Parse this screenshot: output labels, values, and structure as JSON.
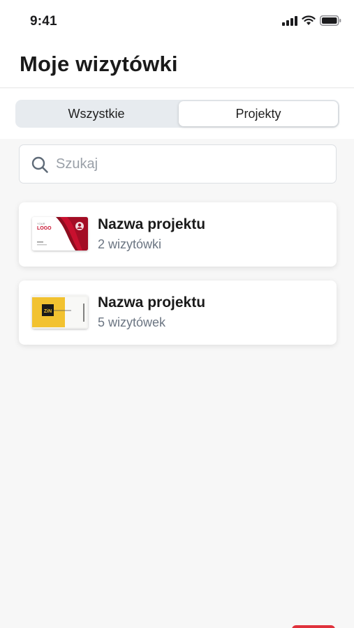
{
  "status_bar": {
    "time": "9:41",
    "icons": [
      "signal-icon",
      "wifi-icon",
      "battery-icon"
    ]
  },
  "header": {
    "title": "Moje wizytówki"
  },
  "tabs": {
    "items": [
      {
        "label": "Wszystkie",
        "selected": false
      },
      {
        "label": "Projekty",
        "selected": true
      }
    ]
  },
  "search": {
    "placeholder": "Szukaj",
    "value": "",
    "icon": "search-icon"
  },
  "projects": [
    {
      "name": "Nazwa projektu",
      "count": "2 wizytówki",
      "thumbnail": {
        "icon": "business-card-red-thumbnail",
        "logo_text": "LOGO",
        "logo_small": "YOUR",
        "accent": "#c8102e"
      }
    },
    {
      "name": "Nazwa projektu",
      "count": "5 wizytówek",
      "thumbnail": {
        "icon": "business-card-yellow-thumbnail",
        "logo_text": "ZiN",
        "accent": "#f2c230"
      }
    }
  ],
  "colors": {
    "background": "#f7f7f7",
    "card": "#ffffff",
    "segment_bg": "#e7ebef",
    "muted_text": "#6b7582",
    "red_accent": "#e0323c"
  }
}
